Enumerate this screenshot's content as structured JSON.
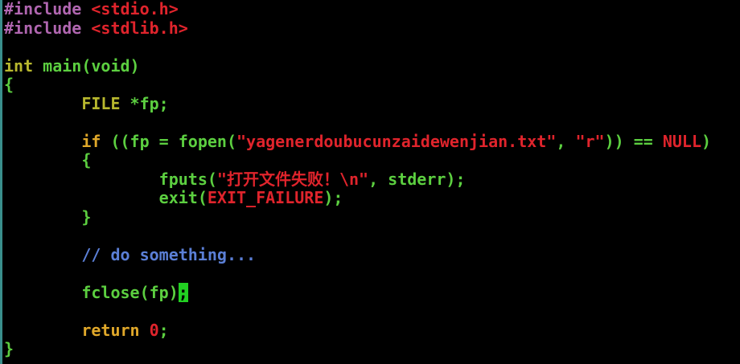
{
  "lines": {
    "l1": {
      "directive": "#include",
      "header": "<stdio.h>"
    },
    "l2": {
      "directive": "#include",
      "header": "<stdlib.h>"
    },
    "l4": {
      "type": "int",
      "fn": " main(void)"
    },
    "l5": {
      "brace": "{"
    },
    "l6": {
      "indent": "        ",
      "type": "FILE",
      "rest": " *fp;"
    },
    "l8": {
      "indent": "        ",
      "kw": "if",
      "rest": " ((fp = fopen(",
      "str1": "\"yagenerdoubucunzaidewenjian.txt\"",
      "sep": ", ",
      "str2": "\"r\"",
      "close": ")) == ",
      "null": "NULL",
      "close2": ")"
    },
    "l9": {
      "indent": "        ",
      "brace": "{"
    },
    "l10": {
      "indent": "                ",
      "fn": "fputs(",
      "str": "\"打开文件失败！\\n\"",
      "rest": ", stderr);"
    },
    "l11": {
      "indent": "                ",
      "fn": "exit(",
      "const": "EXIT_FAILURE",
      "rest": ");"
    },
    "l12": {
      "indent": "        ",
      "brace": "}"
    },
    "l14": {
      "indent": "        ",
      "comment": "// do something..."
    },
    "l16": {
      "indent": "        ",
      "fn": "fclose(fp)",
      "cursor": ";"
    },
    "l18": {
      "indent": "        ",
      "kw": "return",
      "space": " ",
      "num": "0",
      "semi": ";"
    },
    "l19": {
      "brace": "}"
    }
  },
  "colors": {
    "background": "#000000",
    "preprocessor": "#b066b0",
    "string": "#e0242c",
    "type": "#b8b82e",
    "code": "#5ccf40",
    "keyword": "#e0a82a",
    "comment": "#5b7fd6",
    "cursor": "#22d022"
  }
}
